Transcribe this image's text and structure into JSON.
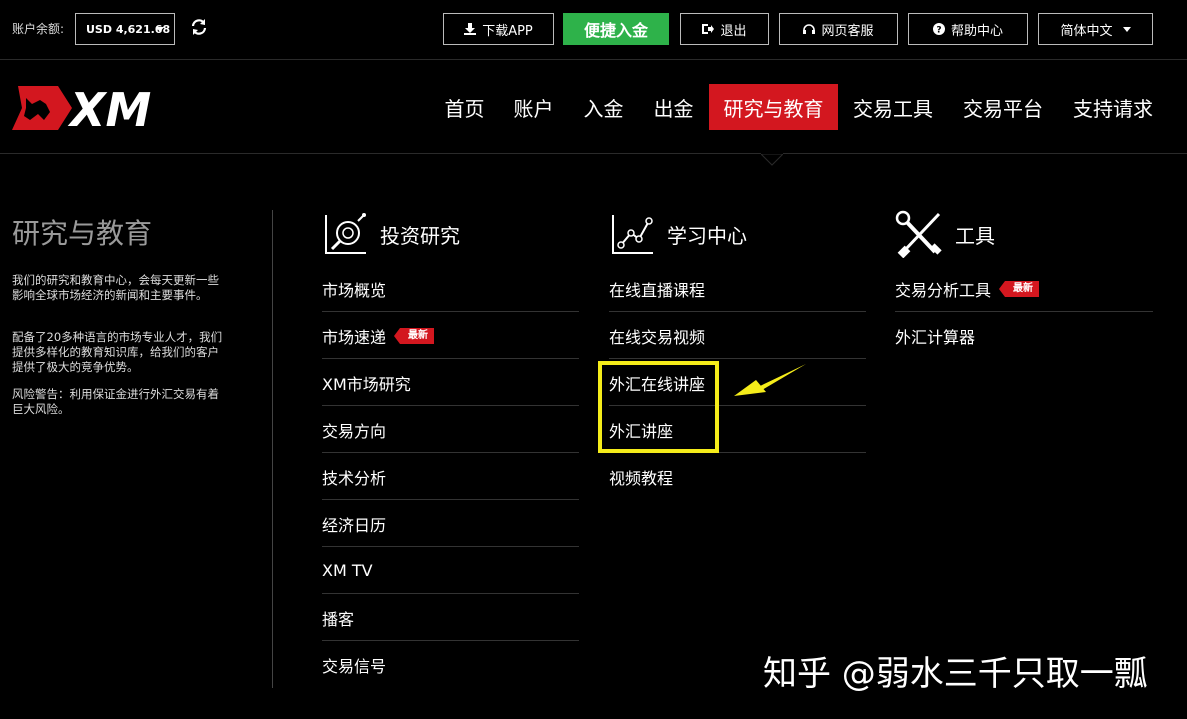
{
  "topbar": {
    "balance_label": "账户余额:",
    "balance_value": "USD 4,621.68",
    "download_label": "下载APP",
    "deposit_label": "便捷入金",
    "logout_label": "退出",
    "support_label": "网页客服",
    "help_label": "帮助中心",
    "language_label": "简体中文"
  },
  "logo": {
    "text": "XM",
    "brand_color": "#d3171f"
  },
  "nav": {
    "items": [
      "首页",
      "账户",
      "入金",
      "出金",
      "研究与教育",
      "交易工具",
      "交易平台",
      "支持请求"
    ],
    "active": "研究与教育",
    "active_color": "#d3171f"
  },
  "intro": {
    "title": "研究与教育",
    "p1": "我们的研究和教育中心，会每天更新一些影响全球市场经济的新闻和主要事件。",
    "p2": "配备了20多种语言的市场专业人才，我们提供多样化的教育知识库，给我们的客户提供了极大的竞争优势。",
    "p3": "风险警告：利用保证金进行外汇交易有着巨大风险。"
  },
  "columns": {
    "research": {
      "title": "投资研究",
      "icon": "magnifier-chart-icon",
      "links": [
        "市场概览",
        "市场速递",
        "XM市场研究",
        "交易方向",
        "技术分析",
        "经济日历",
        "XM TV",
        "播客",
        "交易信号"
      ],
      "badge_index": 1
    },
    "learning": {
      "title": "学习中心",
      "icon": "line-chart-icon",
      "links": [
        "在线直播课程",
        "在线交易视频",
        "外汇在线讲座",
        "外汇讲座",
        "视频教程"
      ]
    },
    "tools": {
      "title": "工具",
      "icon": "wrench-screwdriver-icon",
      "links": [
        "交易分析工具",
        "外汇计算器"
      ],
      "badge_index": 0
    }
  },
  "badge_label": "最新",
  "annotation": {
    "highlight_color": "#f5ec1a"
  },
  "watermark": "知乎 @弱水三千只取一瓢"
}
